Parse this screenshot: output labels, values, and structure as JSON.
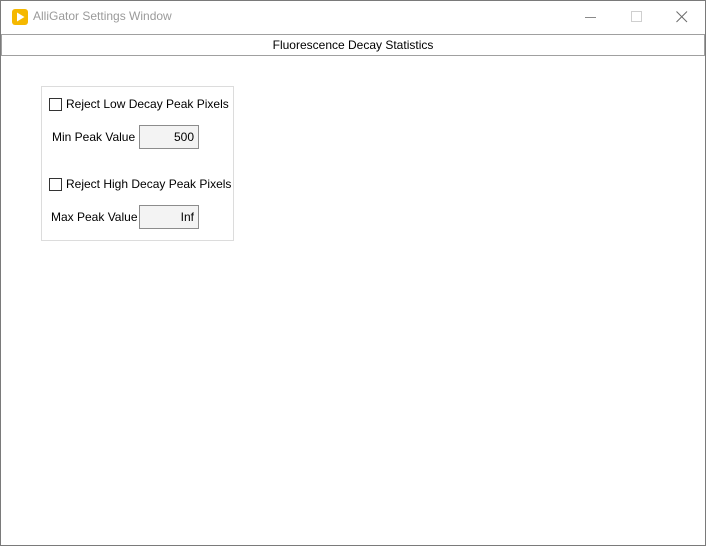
{
  "window": {
    "title": "AlliGator Settings Window",
    "icon": "play-icon",
    "accent_color": "#f5b800",
    "controls": [
      "minimize-icon",
      "maximize-icon",
      "close-icon"
    ]
  },
  "section": {
    "title": "Fluorescence Decay Statistics"
  },
  "group": {
    "reject_low": {
      "label": "Reject Low Decay Peak Pixels",
      "checked": false
    },
    "min_peak": {
      "label": "Min Peak Value",
      "value": "500"
    },
    "reject_high": {
      "label": "Reject High Decay Peak Pixels",
      "checked": false
    },
    "max_peak": {
      "label": "Max Peak Value",
      "value": "Inf"
    }
  }
}
